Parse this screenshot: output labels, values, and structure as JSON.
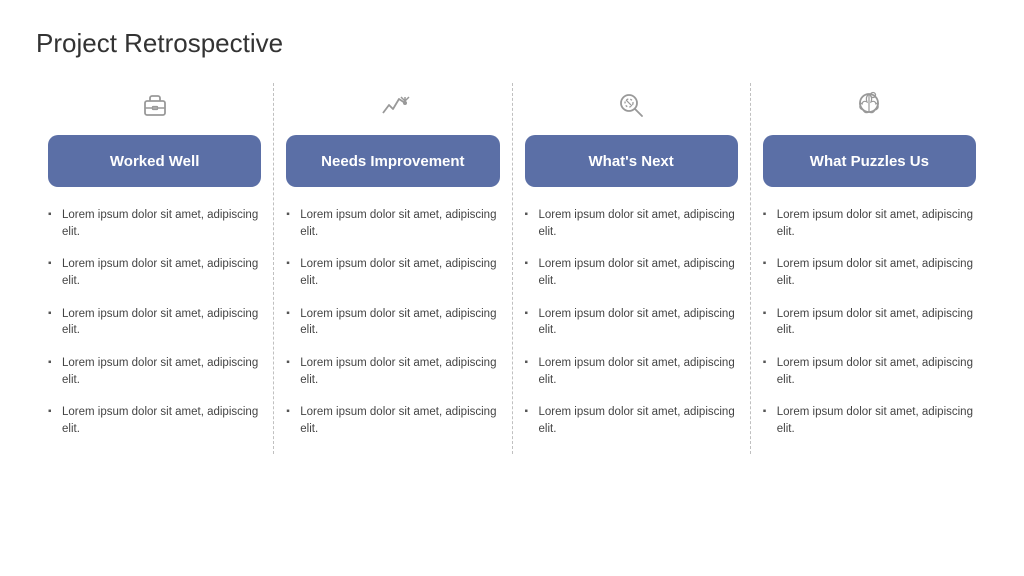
{
  "title": "Project Retrospective",
  "columns": [
    {
      "id": "worked-well",
      "header": "Worked Well",
      "icon": "briefcase",
      "items": [
        "Lorem ipsum dolor sit amet, adipiscing elit.",
        "Lorem ipsum dolor sit amet, adipiscing elit.",
        "Lorem ipsum dolor sit amet, adipiscing elit.",
        "Lorem ipsum dolor sit amet, adipiscing elit.",
        "Lorem ipsum dolor sit amet, adipiscing elit."
      ]
    },
    {
      "id": "needs-improvement",
      "header": "Needs Improvement",
      "icon": "graph",
      "items": [
        "Lorem ipsum dolor sit amet, adipiscing elit.",
        "Lorem ipsum dolor sit amet, adipiscing elit.",
        "Lorem ipsum dolor sit amet, adipiscing elit.",
        "Lorem ipsum dolor sit amet, adipiscing elit.",
        "Lorem ipsum dolor sit amet, adipiscing elit."
      ]
    },
    {
      "id": "whats-next",
      "header": "What's Next",
      "icon": "search",
      "items": [
        "Lorem ipsum dolor sit amet, adipiscing elit.",
        "Lorem ipsum dolor sit amet, adipiscing elit.",
        "Lorem ipsum dolor sit amet, adipiscing elit.",
        "Lorem ipsum dolor sit amet, adipiscing elit.",
        "Lorem ipsum dolor sit amet, adipiscing elit."
      ]
    },
    {
      "id": "what-puzzles-us",
      "header": "What Puzzles Us",
      "icon": "brain",
      "items": [
        "Lorem ipsum dolor sit amet, adipiscing elit.",
        "Lorem ipsum dolor sit amet, adipiscing elit.",
        "Lorem ipsum dolor sit amet, adipiscing elit.",
        "Lorem ipsum dolor sit amet, adipiscing elit.",
        "Lorem ipsum dolor sit amet, adipiscing elit."
      ]
    }
  ]
}
